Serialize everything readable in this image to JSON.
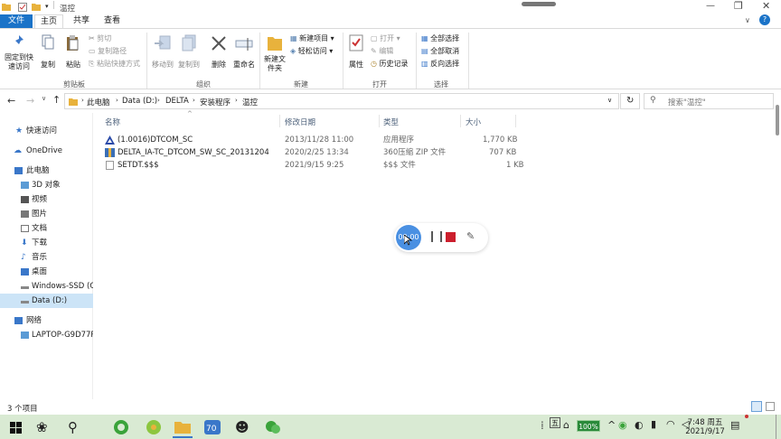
{
  "window": {
    "title": "温控"
  },
  "tabs": [
    {
      "label": "文件"
    },
    {
      "label": "主页"
    },
    {
      "label": "共享"
    },
    {
      "label": "查看"
    }
  ],
  "ribbon": {
    "pin": "固定到快速访问",
    "copy": "复制",
    "paste": "粘贴",
    "cut": "剪切",
    "copy_path": "复制路径",
    "paste_shortcut": "粘贴快捷方式",
    "move_to": "移动到",
    "copy_to": "复制到",
    "delete": "删除",
    "rename": "重命名",
    "new_folder": "新建文件夹",
    "new_item": "新建项目",
    "easy_access": "轻松访问",
    "properties": "属性",
    "open": "打开",
    "edit": "编辑",
    "history": "历史记录",
    "select_all": "全部选择",
    "select_none": "全部取消",
    "invert": "反向选择",
    "groups": {
      "clipboard": "剪贴板",
      "organize": "组织",
      "new": "新建",
      "open": "打开",
      "select": "选择"
    }
  },
  "address": {
    "crumbs": [
      "此电脑",
      "Data (D:)",
      "DELTA",
      "安装程序",
      "温控"
    ],
    "search_placeholder": "搜索\"温控\""
  },
  "nav": [
    {
      "label": "快速访问"
    },
    {
      "label": "OneDrive"
    },
    {
      "label": "此电脑"
    },
    {
      "label": "3D 对象"
    },
    {
      "label": "视频"
    },
    {
      "label": "图片"
    },
    {
      "label": "文档"
    },
    {
      "label": "下载"
    },
    {
      "label": "音乐"
    },
    {
      "label": "桌面"
    },
    {
      "label": "Windows-SSD (C:"
    },
    {
      "label": "Data (D:)"
    },
    {
      "label": "网络"
    },
    {
      "label": "LAPTOP-G9D77R"
    }
  ],
  "columns": {
    "name": "名称",
    "date": "修改日期",
    "type": "类型",
    "size": "大小"
  },
  "files": [
    {
      "name": "(1.0016)DTCOM_SC",
      "date": "2013/11/28 11:00",
      "type": "应用程序",
      "size": "1,770 KB"
    },
    {
      "name": "DELTA_IA-TC_DTCOM_SW_SC_20131204",
      "date": "2020/2/25 13:34",
      "type": "360压缩 ZIP 文件",
      "size": "707 KB"
    },
    {
      "name": "SETDT.$$$",
      "date": "2021/9/15 9:25",
      "type": "$$$ 文件",
      "size": "1 KB"
    }
  ],
  "recorder": {
    "time": "00:00"
  },
  "status": {
    "count": "3 个项目"
  },
  "taskbar": {
    "time": "7:48 周五",
    "date": "2021/9/17",
    "battery": "100%",
    "ime": "五"
  }
}
